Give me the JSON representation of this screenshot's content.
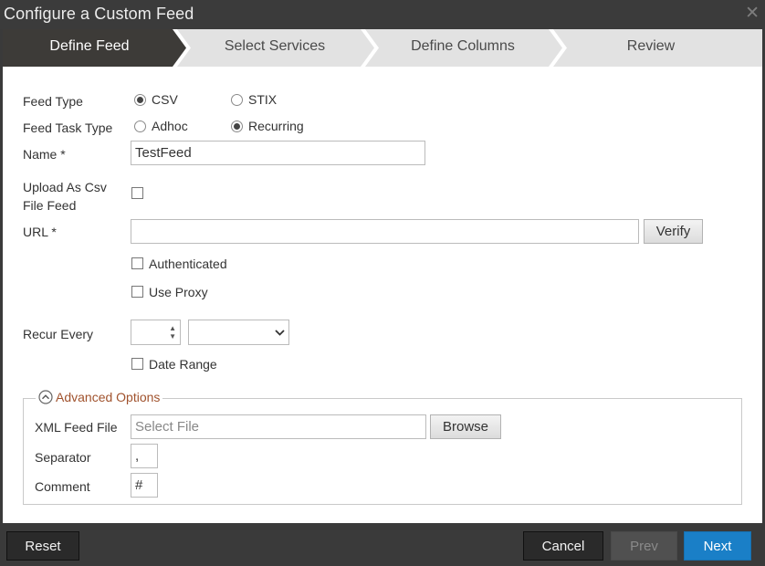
{
  "window": {
    "title": "Configure a Custom Feed",
    "close_icon": "close-icon"
  },
  "wizard": {
    "steps": [
      {
        "label": "Define Feed",
        "active": true
      },
      {
        "label": "Select Services",
        "active": false
      },
      {
        "label": "Define Columns",
        "active": false
      },
      {
        "label": "Review",
        "active": false
      }
    ]
  },
  "form": {
    "feed_type": {
      "label": "Feed Type",
      "options": [
        "CSV",
        "STIX"
      ],
      "selected": "CSV"
    },
    "feed_task_type": {
      "label": "Feed Task Type",
      "options": [
        "Adhoc",
        "Recurring"
      ],
      "selected": "Recurring"
    },
    "name": {
      "label": "Name *",
      "value": "TestFeed"
    },
    "upload_csv": {
      "label_line1": "Upload As Csv",
      "label_line2": "File Feed",
      "checked": false
    },
    "url": {
      "label": "URL *",
      "value": "",
      "verify_label": "Verify"
    },
    "authenticated": {
      "label": "Authenticated",
      "checked": false
    },
    "use_proxy": {
      "label": "Use Proxy",
      "checked": false
    },
    "recur_every": {
      "label": "Recur Every",
      "number": "",
      "unit": ""
    },
    "date_range": {
      "label": "Date Range",
      "checked": false
    }
  },
  "advanced": {
    "legend": "Advanced Options",
    "toggle_icon": "chevron-up-circle-icon",
    "xml_feed_file": {
      "label": "XML Feed File",
      "placeholder": "Select File",
      "browse_label": "Browse"
    },
    "separator": {
      "label": "Separator",
      "value": ","
    },
    "comment": {
      "label": "Comment",
      "value": "#"
    }
  },
  "footer": {
    "reset_label": "Reset",
    "cancel_label": "Cancel",
    "prev_label": "Prev",
    "next_label": "Next"
  },
  "colors": {
    "active_step": "#3d3b38",
    "inactive_step": "#e2e2e2",
    "primary": "#1a7fc7",
    "legend_text": "#a0522d"
  }
}
